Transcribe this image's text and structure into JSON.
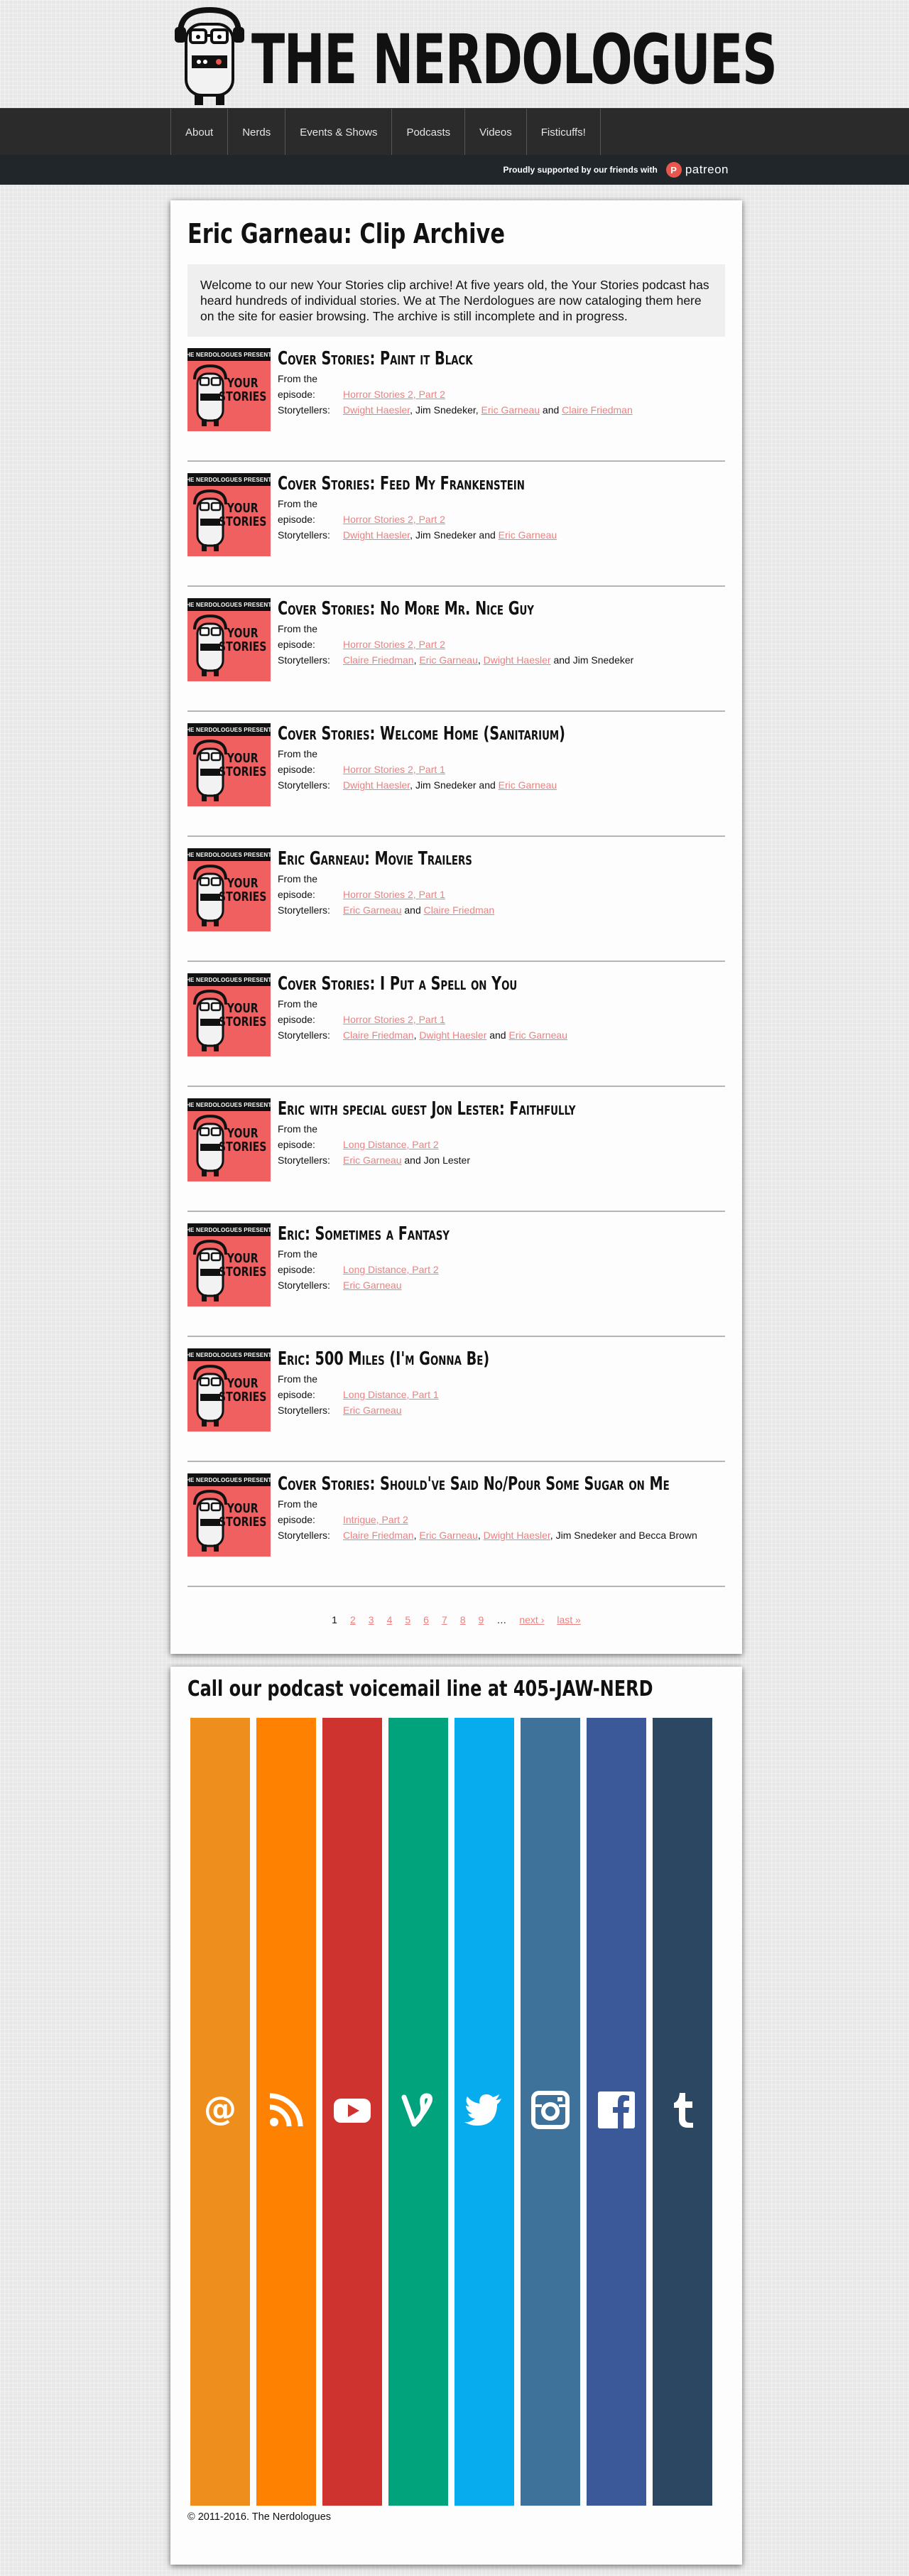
{
  "site": {
    "title": "THE NERDOLOGUES"
  },
  "nav": {
    "items": [
      "About",
      "Nerds",
      "Events & Shows",
      "Podcasts",
      "Videos",
      "Fisticuffs!"
    ]
  },
  "patreon": {
    "text": "Proudly supported by our friends with",
    "brand": "patreon"
  },
  "page": {
    "title": "Eric Garneau: Clip Archive",
    "intro": "Welcome to our new Your Stories clip archive! At five years old, the Your Stories podcast has heard hundreds of individual stories. We at The Nerdologues are now cataloging them here on the site for easier browsing. The archive is still incomplete and in progress."
  },
  "labels": {
    "episode": "From the episode:",
    "storytellers": "Storytellers:"
  },
  "thumb": {
    "band": "THE NERDOLOGUES PRESENTS",
    "line1": "YOUR",
    "line2": "STORIES"
  },
  "clips": [
    {
      "title": "Cover Stories: Paint it Black",
      "episode": "Horror Stories 2, Part 2",
      "tellers": [
        {
          "t": "Dwight Haesler",
          "l": true
        },
        {
          "t": ", ",
          "l": false
        },
        {
          "t": "Jim Snedeker",
          "l": false
        },
        {
          "t": ", ",
          "l": false
        },
        {
          "t": "Eric Garneau",
          "l": true
        },
        {
          "t": " and ",
          "l": false
        },
        {
          "t": "Claire Friedman",
          "l": true
        }
      ]
    },
    {
      "title": "Cover Stories: Feed My Frankenstein",
      "episode": "Horror Stories 2, Part 2",
      "tellers": [
        {
          "t": "Dwight Haesler",
          "l": true
        },
        {
          "t": ", ",
          "l": false
        },
        {
          "t": "Jim Snedeker",
          "l": false
        },
        {
          "t": " and ",
          "l": false
        },
        {
          "t": "Eric Garneau",
          "l": true
        }
      ]
    },
    {
      "title": "Cover Stories: No More Mr. Nice Guy",
      "episode": "Horror Stories 2, Part 2",
      "tellers": [
        {
          "t": "Claire Friedman",
          "l": true
        },
        {
          "t": ", ",
          "l": false
        },
        {
          "t": "Eric Garneau",
          "l": true
        },
        {
          "t": ", ",
          "l": false
        },
        {
          "t": "Dwight Haesler",
          "l": true
        },
        {
          "t": " and ",
          "l": false
        },
        {
          "t": "Jim Snedeker",
          "l": false
        }
      ]
    },
    {
      "title": "Cover Stories: Welcome Home (Sanitarium)",
      "episode": "Horror Stories 2, Part 1",
      "tellers": [
        {
          "t": "Dwight Haesler",
          "l": true
        },
        {
          "t": ", ",
          "l": false
        },
        {
          "t": "Jim Snedeker",
          "l": false
        },
        {
          "t": " and ",
          "l": false
        },
        {
          "t": "Eric Garneau",
          "l": true
        }
      ]
    },
    {
      "title": "Eric Garneau: Movie Trailers",
      "episode": "Horror Stories 2, Part 1",
      "tellers": [
        {
          "t": "Eric Garneau",
          "l": true
        },
        {
          "t": " and ",
          "l": false
        },
        {
          "t": "Claire Friedman",
          "l": true
        }
      ]
    },
    {
      "title": "Cover Stories: I Put a Spell on You",
      "episode": "Horror Stories 2, Part 1",
      "tellers": [
        {
          "t": "Claire Friedman",
          "l": true
        },
        {
          "t": ", ",
          "l": false
        },
        {
          "t": "Dwight Haesler",
          "l": true
        },
        {
          "t": " and ",
          "l": false
        },
        {
          "t": "Eric Garneau",
          "l": true
        }
      ]
    },
    {
      "title": "Eric with special guest Jon Lester: Faithfully",
      "episode": "Long Distance, Part 2",
      "tellers": [
        {
          "t": "Eric Garneau",
          "l": true
        },
        {
          "t": " and ",
          "l": false
        },
        {
          "t": "Jon Lester",
          "l": false
        }
      ]
    },
    {
      "title": "Eric: Sometimes a Fantasy",
      "episode": "Long Distance, Part 2",
      "tellers": [
        {
          "t": "Eric Garneau",
          "l": true
        }
      ]
    },
    {
      "title": "Eric: 500 Miles (I'm Gonna Be)",
      "episode": "Long Distance, Part 1",
      "tellers": [
        {
          "t": "Eric Garneau",
          "l": true
        }
      ]
    },
    {
      "title": "Cover Stories: Should've Said No/Pour Some Sugar on Me",
      "episode": "Intrigue, Part 2",
      "tellers": [
        {
          "t": "Claire Friedman",
          "l": true
        },
        {
          "t": ", ",
          "l": false
        },
        {
          "t": "Eric Garneau",
          "l": true
        },
        {
          "t": ", ",
          "l": false
        },
        {
          "t": "Dwight Haesler",
          "l": true
        },
        {
          "t": ", ",
          "l": false
        },
        {
          "t": "Jim Snedeker",
          "l": false
        },
        {
          "t": " and ",
          "l": false
        },
        {
          "t": "Becca Brown",
          "l": false
        }
      ]
    }
  ],
  "pager": {
    "current": "1",
    "pages": [
      "2",
      "3",
      "4",
      "5",
      "6",
      "7",
      "8",
      "9"
    ],
    "ellipsis": "…",
    "next": "next ›",
    "last": "last »"
  },
  "voicemail": {
    "title": "Call our podcast voicemail line at 405-JAW-NERD"
  },
  "social": [
    {
      "name": "email-icon",
      "color": "#ee8e1c"
    },
    {
      "name": "rss-icon",
      "color": "#ff8102"
    },
    {
      "name": "youtube-icon",
      "color": "#cf3330"
    },
    {
      "name": "vine-icon",
      "color": "#00a37c"
    },
    {
      "name": "twitter-icon",
      "color": "#06aced"
    },
    {
      "name": "instagram-icon",
      "color": "#3f729b"
    },
    {
      "name": "facebook-icon",
      "color": "#3b5998"
    },
    {
      "name": "tumblr-icon",
      "color": "#2c4762"
    }
  ],
  "footer": {
    "copyright": "© 2011-2016. The Nerdologues"
  }
}
